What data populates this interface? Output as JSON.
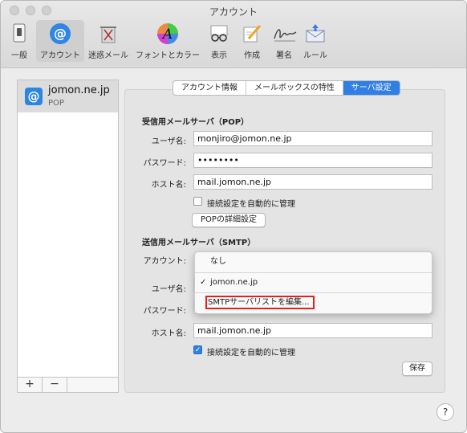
{
  "window": {
    "title": "アカウント"
  },
  "toolbar": {
    "items": [
      {
        "label": "一般",
        "icon": "switch-icon"
      },
      {
        "label": "アカウント",
        "icon": "at-icon"
      },
      {
        "label": "迷惑メール",
        "icon": "junk-trash-icon"
      },
      {
        "label": "フォントとカラー",
        "icon": "font-color-icon"
      },
      {
        "label": "表示",
        "icon": "glasses-icon"
      },
      {
        "label": "作成",
        "icon": "compose-pencil-icon"
      },
      {
        "label": "署名",
        "icon": "signature-icon"
      },
      {
        "label": "ルール",
        "icon": "rules-envelope-icon"
      }
    ],
    "active": "アカウント"
  },
  "sidebar": {
    "account_name": "jomon.ne.jp",
    "account_type": "POP",
    "add_label": "+",
    "remove_label": "−"
  },
  "tabs": {
    "items": [
      "アカウント情報",
      "メールボックスの特性",
      "サーバ設定"
    ],
    "selected": "サーバ設定"
  },
  "incoming": {
    "section_title": "受信用メールサーバ（POP）",
    "username_label": "ユーザ名:",
    "username_value": "monjiro@jomon.ne.jp",
    "password_label": "パスワード:",
    "password_value": "••••••••",
    "host_label": "ホスト名:",
    "host_value": "mail.jomon.ne.jp",
    "auto_manage_label": "接続設定を自動的に管理",
    "auto_manage_checked": false,
    "pop_details_button": "POPの詳細設定"
  },
  "outgoing": {
    "section_title": "送信用メールサーバ（SMTP）",
    "account_label": "アカウント:",
    "username_label": "ユーザ名:",
    "password_label": "パスワード:",
    "host_label": "ホスト名:",
    "host_value": "mail.jomon.ne.jp",
    "auto_manage_label": "接続設定を自動的に管理",
    "auto_manage_checked": true
  },
  "dropdown": {
    "options": [
      {
        "label": "なし",
        "checked": false
      },
      {
        "label": "jomon.ne.jp",
        "checked": true
      },
      {
        "label": "SMTPサーバリストを編集...",
        "checked": false
      }
    ],
    "highlight_color": "#e0201c"
  },
  "footer": {
    "save_button": "保存",
    "help_label": "?"
  },
  "colors": {
    "accent": "#2f7fe6"
  }
}
